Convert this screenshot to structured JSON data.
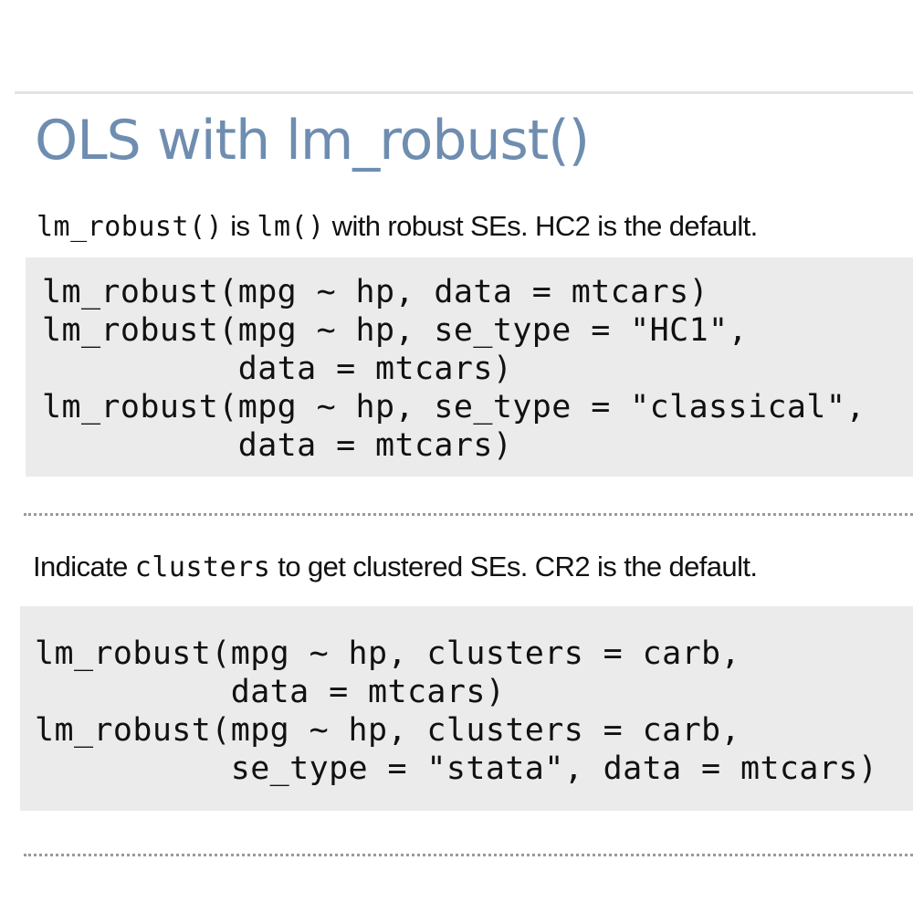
{
  "slide": {
    "title": "OLS with lm_robust()"
  },
  "section1": {
    "intro": {
      "code_a": "lm_robust()",
      "text_a": " is ",
      "code_b": "lm()",
      "text_b": " with robust SEs. HC2 is the default."
    },
    "code_lines": [
      "lm_robust(mpg ~ hp, data = mtcars)",
      "lm_robust(mpg ~ hp, se_type = \"HC1\",",
      "          data = mtcars)",
      "lm_robust(mpg ~ hp, se_type = \"classical\",",
      "          data = mtcars)"
    ]
  },
  "section2": {
    "intro": {
      "text_a": "Indicate ",
      "code_a": "clusters",
      "text_b": " to get clustered SEs. CR2 is the default."
    },
    "code_lines": [
      "lm_robust(mpg ~ hp, clusters = carb,",
      "          data = mtcars)",
      "lm_robust(mpg ~ hp, clusters = carb,",
      "          se_type = \"stata\", data = mtcars)"
    ]
  }
}
